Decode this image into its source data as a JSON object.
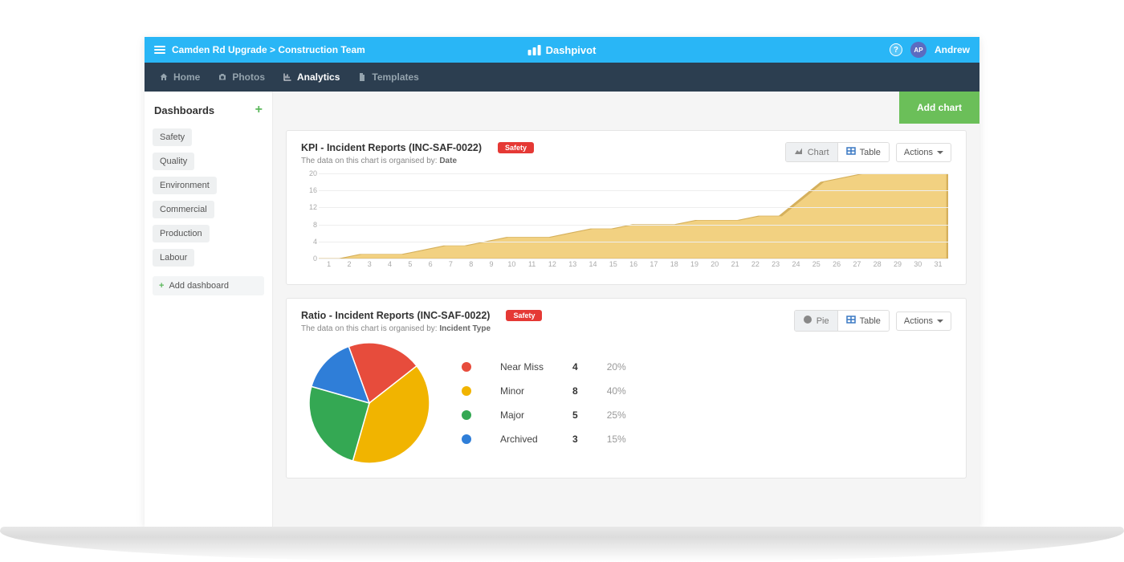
{
  "topbar": {
    "breadcrumb": "Camden Rd Upgrade > Construction Team",
    "brand": "Dashpivot",
    "help": "?",
    "avatar_initials": "AP",
    "user_name": "Andrew"
  },
  "nav": {
    "home": "Home",
    "photos": "Photos",
    "analytics": "Analytics",
    "templates": "Templates"
  },
  "sidebar": {
    "title": "Dashboards",
    "items": [
      "Safety",
      "Quality",
      "Environment",
      "Commercial",
      "Production",
      "Labour"
    ],
    "add_label": "Add dashboard"
  },
  "toolbar": {
    "add_chart": "Add chart"
  },
  "card_kpi": {
    "title": "KPI - Incident Reports (INC-SAF-0022)",
    "badge": "Safety",
    "sub_prefix": "The data on this chart is organised by: ",
    "sub_by": "Date",
    "view_chart": "Chart",
    "view_table": "Table",
    "actions": "Actions"
  },
  "card_ratio": {
    "title": "Ratio - Incident Reports (INC-SAF-0022)",
    "badge": "Safety",
    "sub_prefix": "The data on this chart is organised by: ",
    "sub_by": "Incident Type",
    "view_pie": "Pie",
    "view_table": "Table",
    "actions": "Actions"
  },
  "chart_data": [
    {
      "type": "area",
      "title": "KPI - Incident Reports (INC-SAF-0022)",
      "xlabel": "",
      "ylabel": "",
      "ylim": [
        0,
        20
      ],
      "y_ticks": [
        0,
        4,
        8,
        12,
        16,
        20
      ],
      "categories": [
        1,
        2,
        3,
        4,
        5,
        6,
        7,
        8,
        9,
        10,
        11,
        12,
        13,
        14,
        15,
        16,
        17,
        18,
        19,
        20,
        21,
        22,
        23,
        24,
        25,
        26,
        27,
        28,
        29,
        30,
        31
      ],
      "values": [
        0,
        0,
        1,
        1,
        1,
        2,
        3,
        3,
        4,
        5,
        5,
        5,
        6,
        7,
        7,
        8,
        8,
        8,
        9,
        9,
        9,
        10,
        10,
        14,
        18,
        19,
        20,
        20,
        20,
        21,
        21
      ],
      "fill_color": "#f2d181",
      "line_color": "#d5b05c"
    },
    {
      "type": "pie",
      "title": "Ratio - Incident Reports (INC-SAF-0022)",
      "series": [
        {
          "name": "Near Miss",
          "value": 4,
          "pct": "20%",
          "color": "#e74c3c"
        },
        {
          "name": "Minor",
          "value": 8,
          "pct": "40%",
          "color": "#f1b400"
        },
        {
          "name": "Major",
          "value": 5,
          "pct": "25%",
          "color": "#34a853"
        },
        {
          "name": "Archived",
          "value": 3,
          "pct": "15%",
          "color": "#2f7ed8"
        }
      ]
    }
  ]
}
